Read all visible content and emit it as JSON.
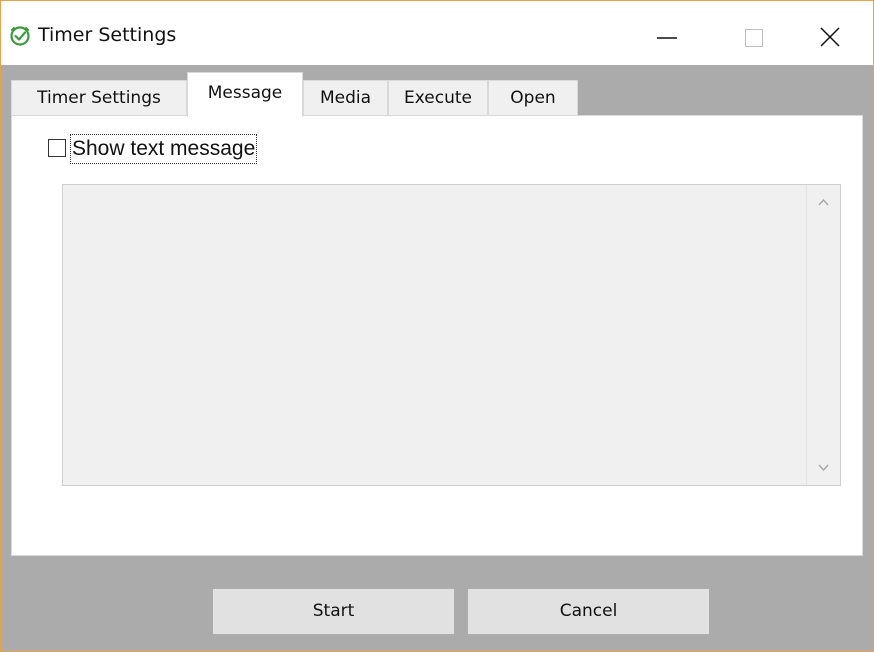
{
  "window": {
    "title": "Timer Settings",
    "icon": "check-circle-icon",
    "accent_color": "#e8a24a",
    "icon_color": "#3a9b3a",
    "controls": [
      "minimize-icon",
      "maximize-icon",
      "close-icon"
    ]
  },
  "tabs": [
    {
      "label": "Timer Settings",
      "active": false
    },
    {
      "label": "Message",
      "active": true
    },
    {
      "label": "Media",
      "active": false
    },
    {
      "label": "Execute",
      "active": false
    },
    {
      "label": "Open",
      "active": false
    }
  ],
  "message": {
    "show_text_checkbox": {
      "label": "Show text message",
      "checked": false
    },
    "text_area": {
      "value": "",
      "enabled": false
    }
  },
  "buttons": {
    "start_label": "Start",
    "cancel_label": "Cancel"
  }
}
